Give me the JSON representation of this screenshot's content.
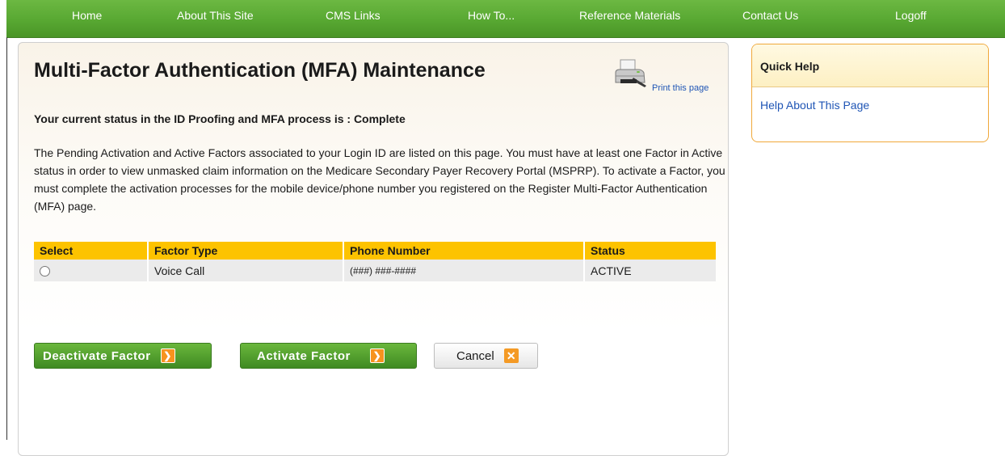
{
  "nav": {
    "items": [
      {
        "label": "Home"
      },
      {
        "label": "About This Site"
      },
      {
        "label": "CMS Links"
      },
      {
        "label": "How To..."
      },
      {
        "label": "Reference Materials"
      },
      {
        "label": "Contact Us"
      },
      {
        "label": "Logoff"
      }
    ]
  },
  "main": {
    "title": "Multi-Factor Authentication (MFA) Maintenance",
    "print_label": "Print this page",
    "status_text": "Your current status in the ID Proofing and MFA process is :  Complete",
    "description": "The Pending Activation and Active Factors associated to your Login ID are listed on this page. You must have at least one Factor in Active status in order to view unmasked claim information on the Medicare Secondary Payer Recovery Portal (MSPRP). To activate a Factor, you must complete the activation processes for the mobile device/phone number you registered on the Register Multi-Factor Authentication (MFA) page.",
    "table": {
      "headers": [
        "Select",
        "Factor Type",
        "Phone Number",
        "Status"
      ],
      "rows": [
        {
          "factor_type": "Voice Call",
          "phone": "(###) ###-####",
          "status": "ACTIVE"
        }
      ]
    },
    "buttons": {
      "deactivate": "Deactivate Factor",
      "activate": "Activate Factor",
      "cancel": "Cancel"
    }
  },
  "help": {
    "title": "Quick Help",
    "link": "Help About This Page"
  },
  "colors": {
    "nav_green": "#58a832",
    "table_header": "#fdc300",
    "link_blue": "#1f55b5",
    "accent_orange": "#f7931e"
  }
}
